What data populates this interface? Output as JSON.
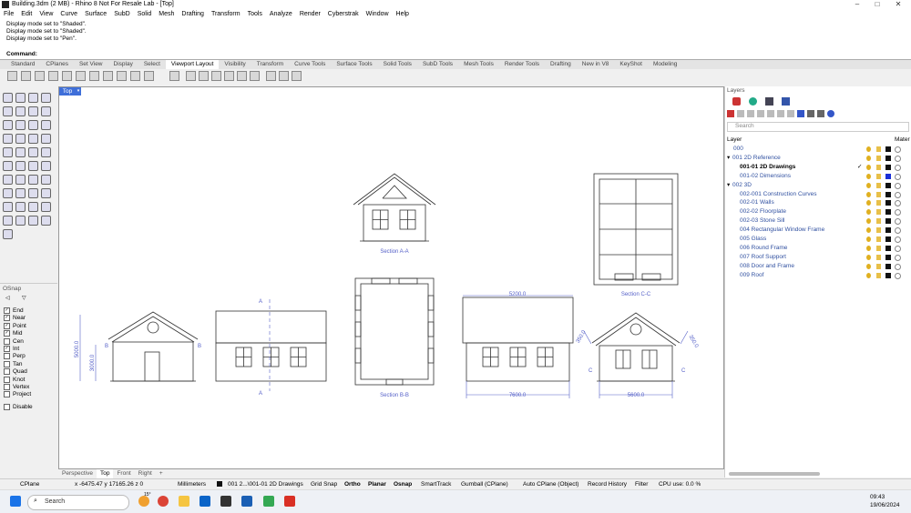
{
  "window": {
    "title": "Building.3dm (2 MB) - Rhino 8 Not For Resale Lab - [Top]",
    "min": "–",
    "max": "□",
    "close": "✕"
  },
  "menu": [
    "File",
    "Edit",
    "View",
    "Curve",
    "Surface",
    "SubD",
    "Solid",
    "Mesh",
    "Drafting",
    "Transform",
    "Tools",
    "Analyze",
    "Render",
    "Cyberstrak",
    "Window",
    "Help"
  ],
  "history": [
    "Display mode set to \"Shaded\".",
    "Display mode set to \"Shaded\".",
    "Display mode set to \"Pen\"."
  ],
  "command_label": "Command:",
  "tabs": [
    "Standard",
    "CPlanes",
    "Set View",
    "Display",
    "Select",
    "Viewport Layout",
    "Visibility",
    "Transform",
    "Curve Tools",
    "Surface Tools",
    "Solid Tools",
    "SubD Tools",
    "Mesh Tools",
    "Render Tools",
    "Drafting",
    "New in V8",
    "KeyShot",
    "Modeling"
  ],
  "active_tab": "Viewport Layout",
  "viewport": {
    "name": "Top",
    "tabs": [
      "Perspective",
      "Top",
      "Front",
      "Right"
    ],
    "active": "Top",
    "add": "+"
  },
  "osnap": {
    "title": "OSnap",
    "items": [
      {
        "label": "End",
        "checked": true
      },
      {
        "label": "Near",
        "checked": true
      },
      {
        "label": "Point",
        "checked": true
      },
      {
        "label": "Mid",
        "checked": true
      },
      {
        "label": "Cen",
        "checked": false
      },
      {
        "label": "Int",
        "checked": true
      },
      {
        "label": "Perp",
        "checked": false
      },
      {
        "label": "Tan",
        "checked": false
      },
      {
        "label": "Quad",
        "checked": false
      },
      {
        "label": "Knot",
        "checked": false
      },
      {
        "label": "Vertex",
        "checked": false
      },
      {
        "label": "Project",
        "checked": false
      }
    ],
    "disable": "Disable"
  },
  "drawing": {
    "section_aa": "Section A-A",
    "section_bb": "Section B-B",
    "section_cc": "Section C-C",
    "dim_5200": "5200.0",
    "dim_7600": "7600.0",
    "dim_5600": "5600.0",
    "dim_5000": "5000.0",
    "dim_3000": "3000.0",
    "dim_350a": "350.0",
    "dim_350b": "350.0",
    "mark_a": "A",
    "mark_b": "B",
    "mark_c": "C"
  },
  "layers": {
    "title": "Layers",
    "search_placeholder": "Search",
    "col_layer": "Layer",
    "col_material": "Mater",
    "rows": [
      {
        "name": "000",
        "indent": 0,
        "color": "#111111",
        "current": false
      },
      {
        "name": "001 2D Reference",
        "indent": 1,
        "color": "#111111",
        "current": false,
        "expander": "▾"
      },
      {
        "name": "001-01 2D Drawings",
        "indent": 2,
        "color": "#111111",
        "current": true,
        "check": "✓"
      },
      {
        "name": "001-02 Dimensions",
        "indent": 2,
        "color": "#1a2fd6",
        "current": false
      },
      {
        "name": "002 3D",
        "indent": 1,
        "color": "#111111",
        "current": false,
        "expander": "▾"
      },
      {
        "name": "002-001 Construction Curves",
        "indent": 2,
        "color": "#111111",
        "current": false
      },
      {
        "name": "002-01 Walls",
        "indent": 2,
        "color": "#111111",
        "current": false
      },
      {
        "name": "002-02 Floorplate",
        "indent": 2,
        "color": "#111111",
        "current": false
      },
      {
        "name": "002-03 Stone Sill",
        "indent": 2,
        "color": "#111111",
        "current": false
      },
      {
        "name": "004 Rectangular Window Frame",
        "indent": 2,
        "color": "#111111",
        "current": false
      },
      {
        "name": "005 Glass",
        "indent": 2,
        "color": "#111111",
        "current": false
      },
      {
        "name": "006 Round Frame",
        "indent": 2,
        "color": "#111111",
        "current": false
      },
      {
        "name": "007 Roof Support",
        "indent": 2,
        "color": "#111111",
        "current": false
      },
      {
        "name": "008 Door and Frame",
        "indent": 2,
        "color": "#111111",
        "current": false
      },
      {
        "name": "009 Roof",
        "indent": 2,
        "color": "#111111",
        "current": false
      }
    ]
  },
  "status": {
    "cplane": "CPlane",
    "coords": "x -6475.47   y 17165.26   z 0",
    "units": "Millimeters",
    "layer": "001 2...\\001-01 2D Drawings",
    "items": [
      "Grid Snap",
      "Ortho",
      "Planar",
      "Osnap",
      "SmartTrack",
      "Gumball (CPlane)",
      "Auto CPlane (Object)",
      "Record History",
      "Filter",
      "CPU use: 0.0 %"
    ]
  },
  "taskbar": {
    "search": "Search",
    "weather": "15°",
    "time": "09:43",
    "date": "19/06/2024"
  }
}
